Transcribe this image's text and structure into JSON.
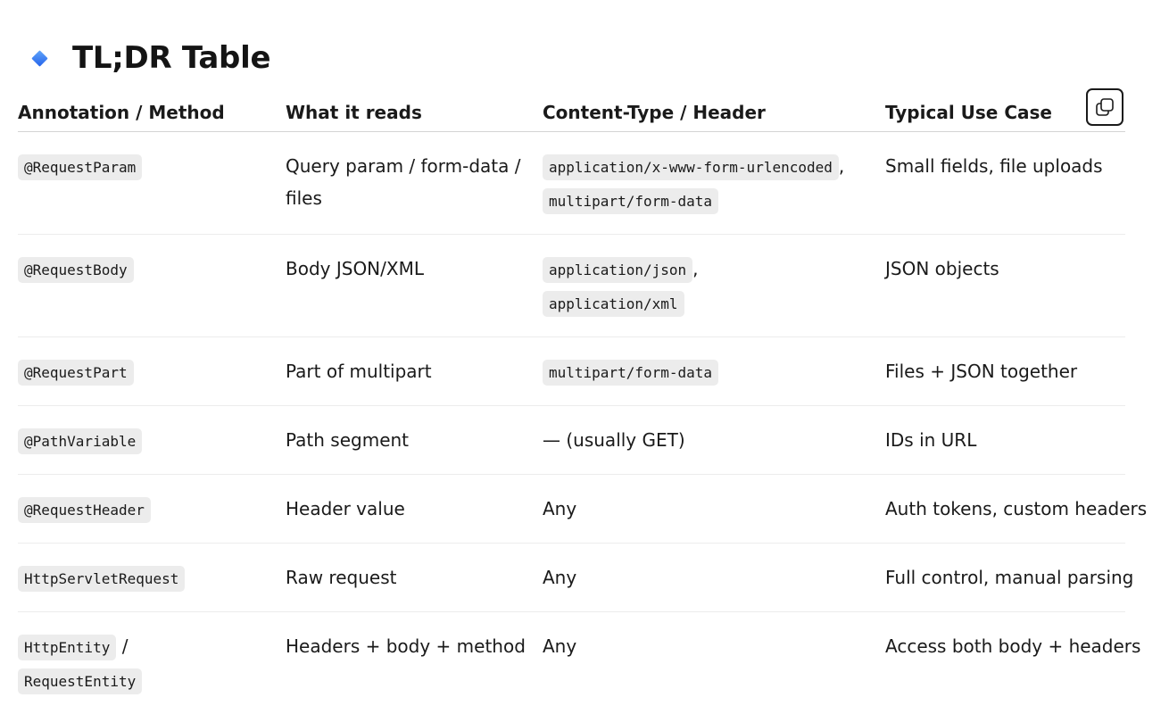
{
  "heading": {
    "title": "TL;DR Table"
  },
  "copy_button": {
    "icon": "copy-icon"
  },
  "table": {
    "headers": [
      "Annotation / Method",
      "What it reads",
      "Content-Type / Header",
      "Typical Use Case"
    ],
    "rows": [
      {
        "method": "@RequestParam",
        "reads": "Query param / form-data / files",
        "content_type_1": "application/x-www-form-urlencoded",
        "content_type_2": "multipart/form-data",
        "use_case": "Small fields, file uploads"
      },
      {
        "method": "@RequestBody",
        "reads": "Body JSON/XML",
        "content_type_1": "application/json",
        "content_type_2": "application/xml",
        "use_case": "JSON objects"
      },
      {
        "method": "@RequestPart",
        "reads": "Part of multipart",
        "content_type_1": "multipart/form-data",
        "use_case": "Files + JSON together"
      },
      {
        "method": "@PathVariable",
        "reads": "Path segment",
        "content_type_text": "— (usually GET)",
        "use_case": "IDs in URL"
      },
      {
        "method": "@RequestHeader",
        "reads": "Header value",
        "content_type_text": "Any",
        "use_case": "Auth tokens, custom headers"
      },
      {
        "method": "HttpServletRequest",
        "reads": "Raw request",
        "content_type_text": "Any",
        "use_case": "Full control, manual parsing"
      },
      {
        "method": "HttpEntity",
        "method_separator": "/",
        "method_2": "RequestEntity",
        "reads": "Headers + body + method",
        "content_type_text": "Any",
        "use_case": "Access both body + headers"
      }
    ]
  }
}
